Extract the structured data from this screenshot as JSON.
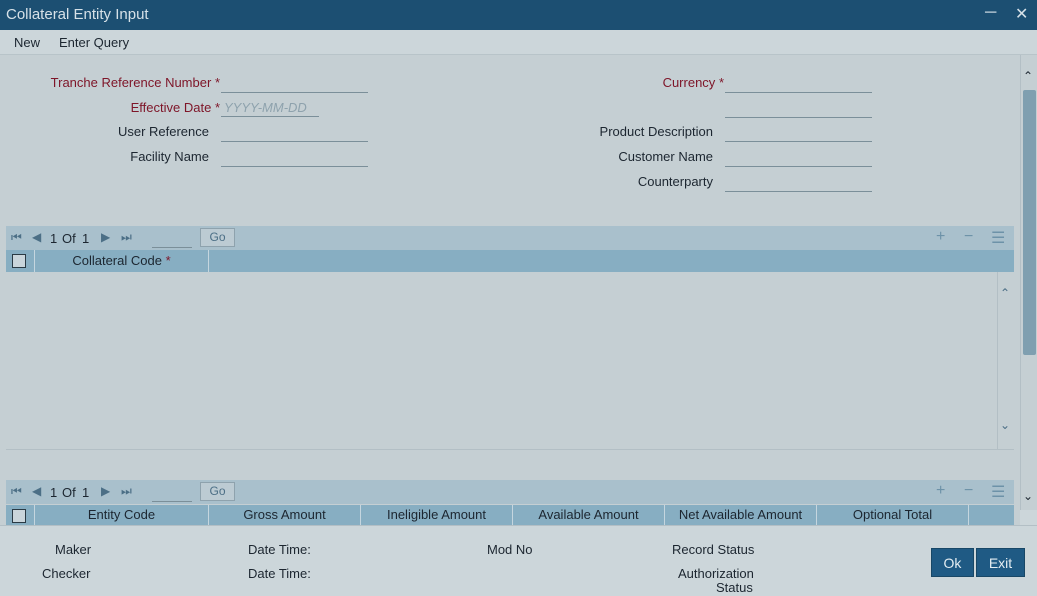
{
  "window": {
    "title": "Collateral Entity Input"
  },
  "menu": {
    "new": "New",
    "enter_query": "Enter Query"
  },
  "form": {
    "tranche_ref_label": "Tranche Reference Number",
    "effective_date_label": "Effective Date",
    "effective_date_placeholder": "YYYY-MM-DD",
    "user_reference_label": "User Reference",
    "facility_name_label": "Facility Name",
    "currency_label": "Currency",
    "product_description_label": "Product Description",
    "customer_name_label": "Customer Name",
    "counterparty_label": "Counterparty",
    "required_mark": "*"
  },
  "grid1": {
    "page_current": "1",
    "page_of": "Of",
    "page_total": "1",
    "go_label": "Go",
    "columns": [
      "Collateral Code"
    ],
    "required_mark": "*"
  },
  "grid2": {
    "page_current": "1",
    "page_of": "Of",
    "page_total": "1",
    "go_label": "Go",
    "columns": [
      "Entity Code",
      "Gross Amount",
      "Ineligible Amount",
      "Available Amount",
      "Net Available Amount",
      "Optional Total"
    ]
  },
  "footer": {
    "maker": "Maker",
    "checker": "Checker",
    "date_time_1": "Date Time:",
    "date_time_2": "Date Time:",
    "mod_no": "Mod No",
    "record_status": "Record Status",
    "authorization_status_line1": "Authorization",
    "authorization_status_line2": "Status"
  },
  "buttons": {
    "ok": "Ok",
    "exit": "Exit"
  },
  "icons": {
    "minimize": "minimize-icon",
    "close": "close-icon",
    "first": "first-page-icon",
    "prev": "previous-page-icon",
    "next": "next-page-icon",
    "last": "last-page-icon",
    "add": "add-row-icon",
    "delete": "delete-row-icon",
    "settings": "list-settings-icon"
  },
  "colors": {
    "titlebar": "#1c4f72",
    "required": "#7e1528",
    "button": "#1f5a84",
    "grid_header": "#87aec2"
  }
}
